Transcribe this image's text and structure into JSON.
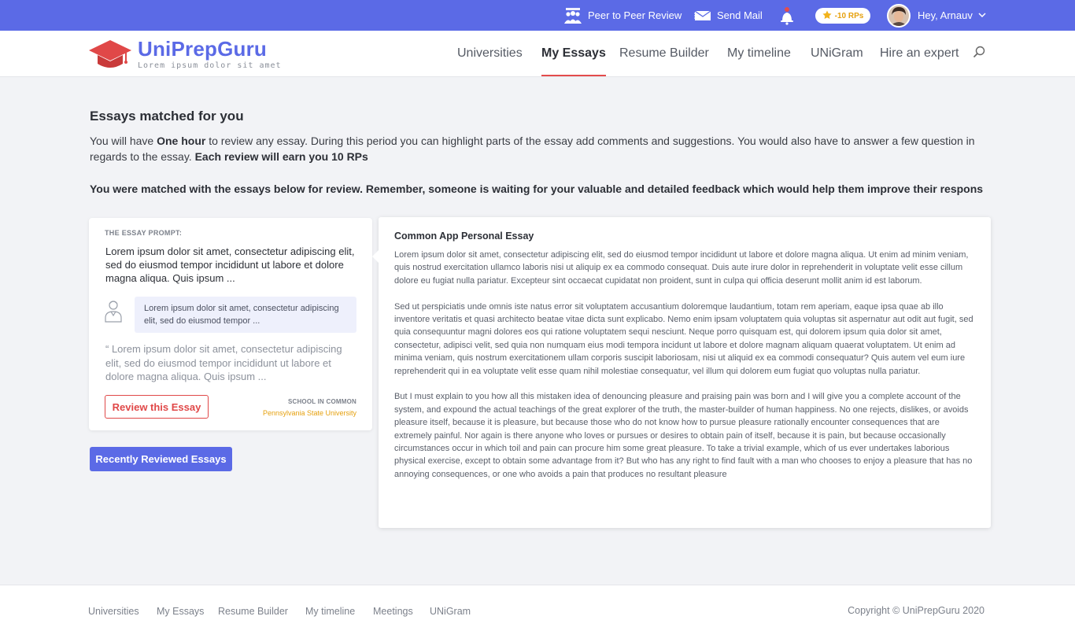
{
  "topbar": {
    "peer_review": "Peer to Peer Review",
    "send_mail": "Send Mail",
    "rp_badge": "-10 RPs",
    "greeting": "Hey, Arnauv"
  },
  "brand": {
    "name": "UniPrepGuru",
    "tagline": "Lorem ipsum dolor sit amet"
  },
  "nav": {
    "items": [
      "Universities",
      "My Essays",
      "Resume Builder",
      "My timeline",
      "UNiGram",
      "Hire an expert"
    ],
    "active": "My Essays"
  },
  "intro": {
    "title": "Essays matched for you",
    "line_pre": "You will have ",
    "one_hour": "One hour",
    "line_mid": " to review any essay. During this period you can highlight parts of the essay add comments and suggestions. You would also have to answer a few question in regards to the essay. ",
    "earn": "Each review will earn you 10 RPs",
    "matched": "You were matched with the essays below for review. Remember, someone is waiting for your valuable and detailed feedback which would help them improve their respons"
  },
  "prompt_card": {
    "label": "THE ESSAY PROMPT:",
    "prompt": "Lorem ipsum dolor sit amet, consectetur adipiscing elit, sed do eiusmod tempor incididunt ut labore et dolore magna aliqua. Quis ipsum ...",
    "bubble": "Lorem ipsum dolor sit amet, consectetur adipiscing elit, sed do eiusmod tempor ...",
    "quote": "“ Lorem ipsum dolor sit amet, consectetur adipiscing elit, sed do eiusmod tempor incididunt ut labore et dolore magna aliqua. Quis ipsum ...",
    "review_button": "Review this Essay",
    "school_label": "SCHOOL IN COMMON",
    "school_name": "Pennsylvania State University"
  },
  "recent_button": "Recently Reviewed Essays",
  "essay": {
    "title": "Common App Personal Essay",
    "paragraphs": [
      "Lorem ipsum dolor sit amet, consectetur adipiscing elit, sed do eiusmod tempor incididunt ut labore et dolore magna aliqua. Ut enim ad minim veniam, quis nostrud exercitation ullamco laboris nisi ut aliquip ex ea commodo consequat. Duis aute irure dolor in reprehenderit in voluptate velit esse cillum dolore eu fugiat nulla pariatur. Excepteur sint occaecat cupidatat non proident, sunt in culpa qui officia deserunt mollit anim id est laborum.",
      "Sed ut perspiciatis unde omnis iste natus error sit voluptatem accusantium doloremque laudantium, totam rem aperiam, eaque ipsa quae ab illo inventore veritatis et quasi architecto beatae vitae dicta sunt explicabo. Nemo enim ipsam voluptatem quia voluptas sit aspernatur aut odit aut fugit, sed quia consequuntur magni dolores eos qui ratione voluptatem sequi nesciunt. Neque porro quisquam est, qui dolorem ipsum quia dolor sit amet, consectetur, adipisci velit, sed quia non numquam eius modi tempora incidunt ut labore et dolore magnam aliquam quaerat voluptatem. Ut enim ad minima veniam, quis nostrum exercitationem ullam corporis suscipit laboriosam, nisi ut aliquid ex ea commodi consequatur? Quis autem vel eum iure reprehenderit qui in ea voluptate velit esse quam nihil molestiae consequatur, vel illum qui dolorem eum fugiat quo voluptas nulla pariatur.",
      "But I must explain to you how all this mistaken idea of denouncing pleasure and praising pain was born and I will give you a complete account of the system, and expound the actual teachings of the great explorer of the truth, the master-builder of human happiness. No one rejects, dislikes, or avoids pleasure itself, because it is pleasure, but because those who do not know how to pursue pleasure rationally encounter consequences that are extremely painful. Nor again is there anyone who loves or pursues or desires to obtain pain of itself, because it is pain, but because occasionally circumstances occur in which toil and pain can procure him some great pleasure. To take a trivial example, which of us ever undertakes laborious physical exercise, except to obtain some advantage from it? But who has any right to find fault with a man who chooses to enjoy a pleasure that has no annoying consequences, or one who avoids a pain that produces no resultant pleasure"
    ]
  },
  "footer": {
    "links": [
      "Universities",
      "My Essays",
      "Resume Builder",
      "My timeline",
      "Meetings",
      "UNiGram"
    ],
    "copyright": "Copyright © UniPrepGuru 2020"
  },
  "icons": {
    "peer_review": "group-icon",
    "send_mail": "envelope-icon",
    "notifications": "bell-icon",
    "rp": "star-icon",
    "logo": "graduation-cap-icon",
    "search": "search-icon",
    "user": "user-outline-icon",
    "dropdown": "chevron-down-icon"
  },
  "colors": {
    "primary": "#5b6ae6",
    "accent_red": "#e04848",
    "gold": "#e6a10f"
  }
}
